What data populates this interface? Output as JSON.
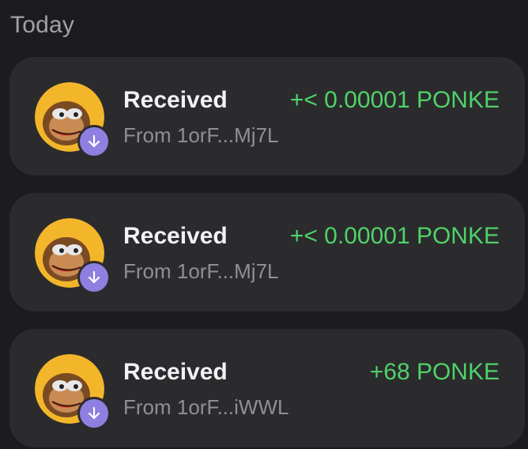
{
  "section": {
    "title": "Today"
  },
  "transactions": [
    {
      "title": "Received",
      "from": "From 1orF...Mj7L",
      "amount": "+< 0.00001 PONKE"
    },
    {
      "title": "Received",
      "from": "From 1orF...Mj7L",
      "amount": "+< 0.00001 PONKE"
    },
    {
      "title": "Received",
      "from": "From 1orF...iWWL",
      "amount": "+68 PONKE"
    }
  ],
  "icons": {
    "avatar": "ponke-token-avatar",
    "badge": "arrow-down-icon"
  },
  "colors": {
    "background": "#1c1c1e",
    "card": "#2b2b2d",
    "amount_positive": "#4fd269",
    "badge": "#8e7fe0"
  }
}
